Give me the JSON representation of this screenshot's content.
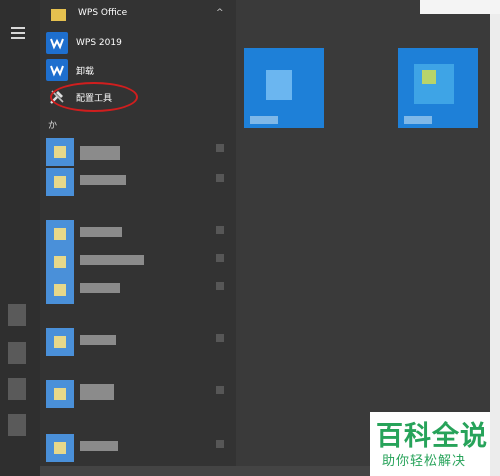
{
  "start_menu": {
    "group": {
      "label": "WPS Office",
      "collapse_symbol": "^"
    },
    "items": [
      {
        "label": "WPS 2019",
        "icon": "wps-icon"
      },
      {
        "label": "卸载",
        "icon": "wps-icon"
      },
      {
        "label": "配置工具",
        "icon": "tools-icon"
      }
    ],
    "section_letter": "か"
  },
  "annotation": {
    "color": "#d01e1e"
  },
  "watermark": {
    "line1": "百科全说",
    "line2": "助你轻松解决",
    "color": "#27a35a"
  },
  "colors": {
    "wps_blue": "#1e6fce",
    "tile_blue": "#1e80d8",
    "folder": "#e6c14f"
  }
}
